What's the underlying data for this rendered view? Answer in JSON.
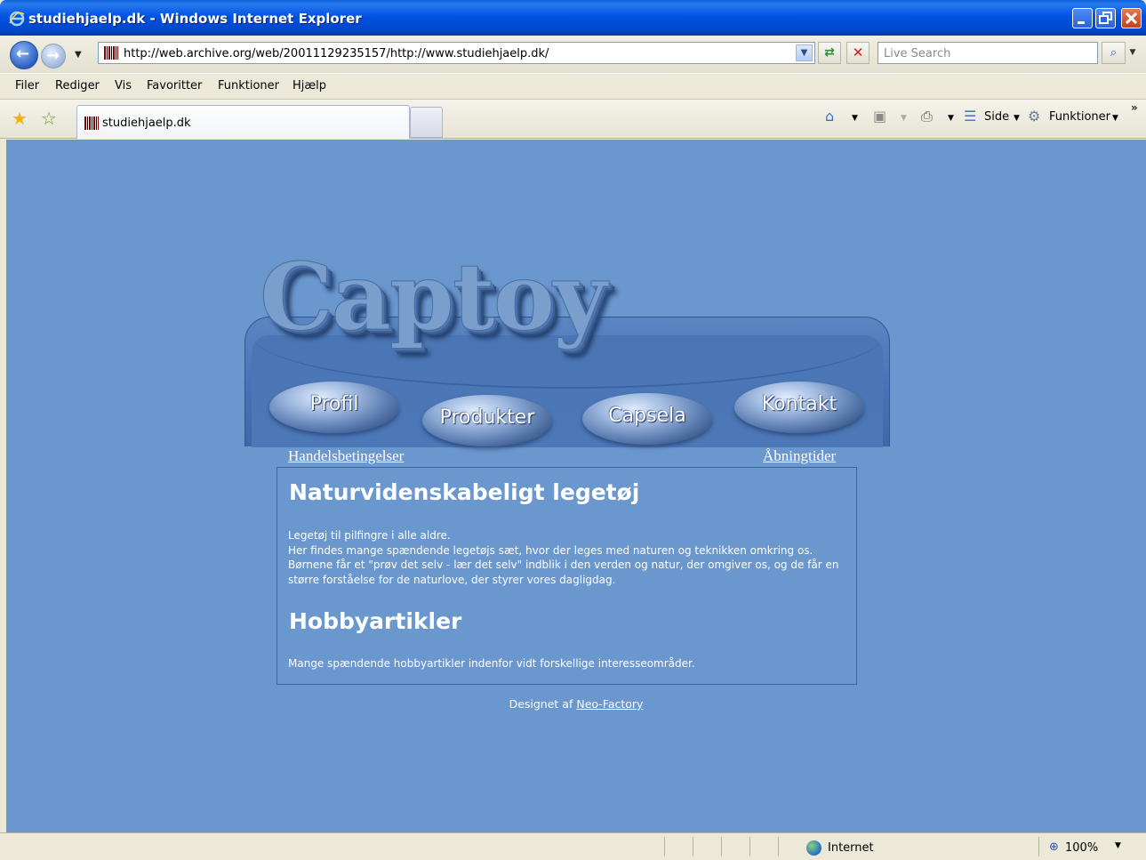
{
  "window": {
    "title": "studiehjaelp.dk - Windows Internet Explorer"
  },
  "address_bar": {
    "url": "http://web.archive.org/web/20011129235157/http://www.studiehjaelp.dk/",
    "search_placeholder": "Live Search"
  },
  "menu": {
    "items": [
      "Filer",
      "Rediger",
      "Vis",
      "Favoritter",
      "Funktioner",
      "Hjælp"
    ]
  },
  "tabs": {
    "active_label": "studiehjaelp.dk"
  },
  "command_bar": {
    "side_label": "Side",
    "funktioner_label": "Funktioner",
    "chevron": "»"
  },
  "page": {
    "logo": "Captoy",
    "nav": [
      "Profil",
      "Produkter",
      "Capsela",
      "Kontakt"
    ],
    "links": {
      "left": "Handelsbetingelser",
      "right": "Åbningtider"
    },
    "section1": {
      "heading": "Naturvidenskabeligt legetøj",
      "lines": [
        "Legetøj til pilfingre i alle aldre.",
        "Her findes mange spændende legetøjs sæt, hvor der leges med naturen og teknikken omkring os.",
        "Børnene får et \"prøv det selv - lær det selv\" indblik i den verden og natur, der omgiver os, og de får en",
        "større forståelse for de naturlove, der styrer vores dagligdag."
      ]
    },
    "section2": {
      "heading": "Hobbyartikler",
      "text": "Mange spændende hobbyartikler indenfor vidt forskellige interesseområder."
    },
    "footer": {
      "prefix": "Designet af",
      "link": "Neo-Factory"
    }
  },
  "status_bar": {
    "zone": "Internet",
    "zoom": "100%"
  },
  "colors": {
    "page_background": "#6b97cf",
    "header_panel": "#4673b6",
    "titlebar": "#0054e3"
  }
}
